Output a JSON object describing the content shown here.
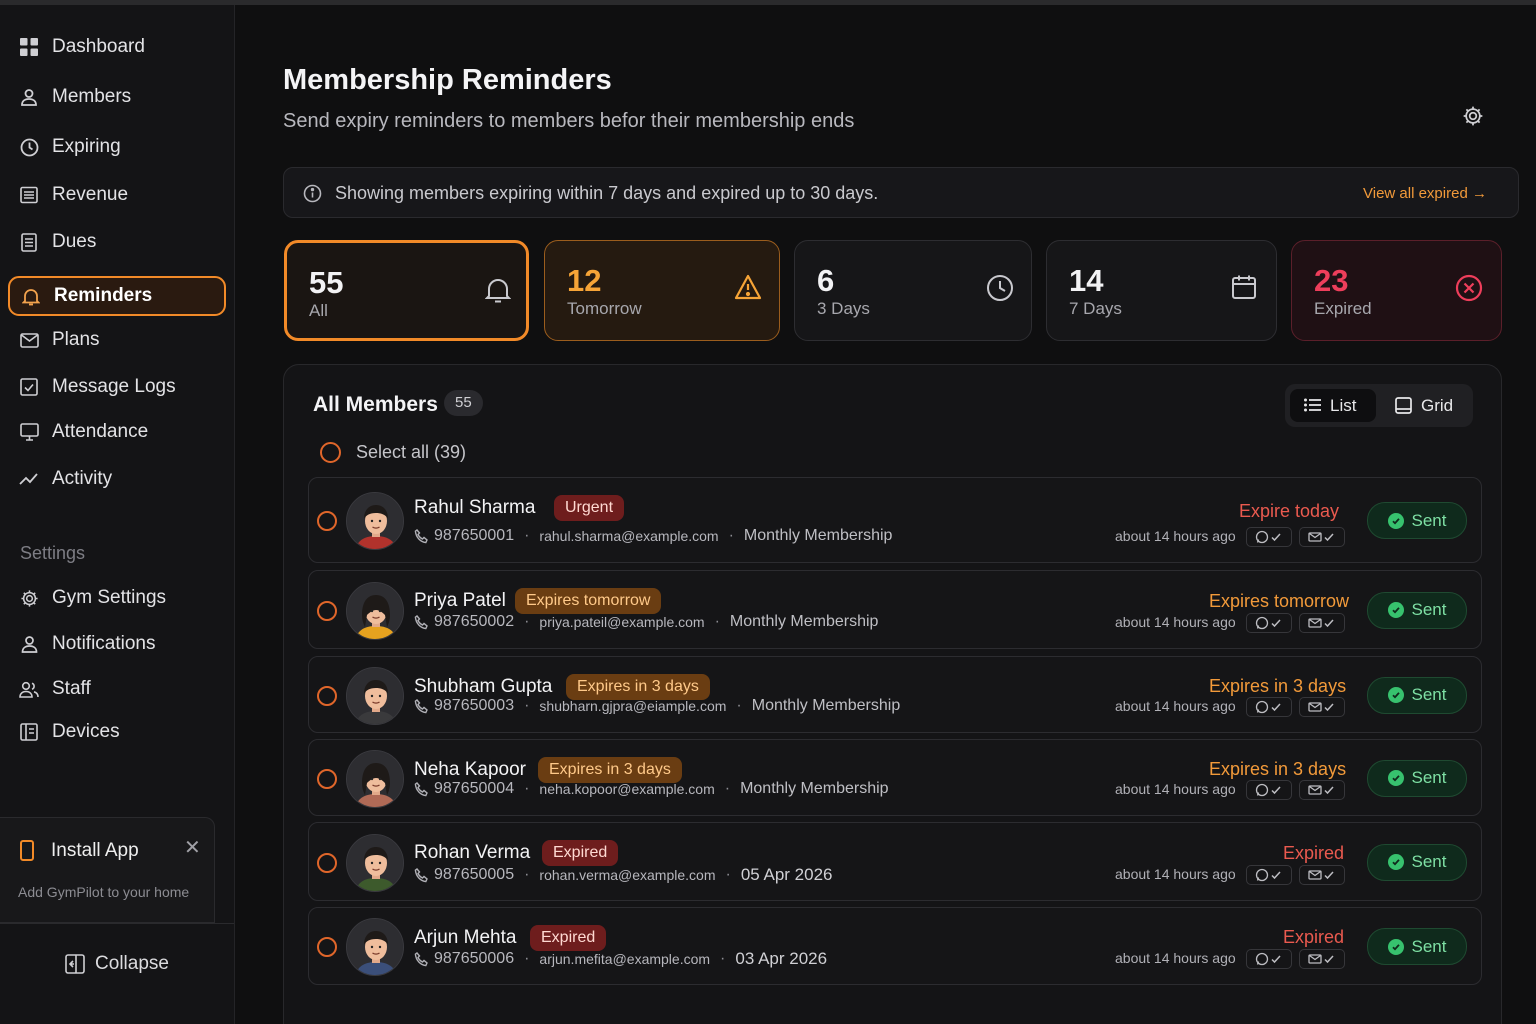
{
  "sidebar": {
    "items": [
      {
        "label": "Dashboard",
        "icon": "grid-icon"
      },
      {
        "label": "Members",
        "icon": "user-icon"
      },
      {
        "label": "Expiring",
        "icon": "clock-icon"
      },
      {
        "label": "Revenue",
        "icon": "receipt-icon"
      },
      {
        "label": "Dues",
        "icon": "document-icon"
      },
      {
        "label": "Reminders",
        "icon": "bell-icon",
        "active": true
      },
      {
        "label": "Plans",
        "icon": "mail-icon"
      },
      {
        "label": "Message Logs",
        "icon": "checkbox-icon"
      },
      {
        "label": "Attendance",
        "icon": "monitor-icon"
      },
      {
        "label": "Activity",
        "icon": "trend-icon"
      }
    ],
    "settings_label": "Settings",
    "settings_items": [
      {
        "label": "Gym Settings",
        "icon": "gear-icon"
      },
      {
        "label": "Notifications",
        "icon": "user-bell-icon"
      },
      {
        "label": "Staff",
        "icon": "users-icon"
      },
      {
        "label": "Devices",
        "icon": "device-icon"
      }
    ],
    "install": {
      "title": "Install App",
      "subtitle": "Add GymPilot to your home"
    },
    "collapse_label": "Collapse"
  },
  "header": {
    "title": "Membership Reminders",
    "subtitle": "Send expiry reminders to members befor their membership ends"
  },
  "info_bar": {
    "text": "Showing members expiring within 7 days and expired up to 30 days.",
    "link": "View all expired →"
  },
  "stats": [
    {
      "count": "55",
      "label": "All"
    },
    {
      "count": "12",
      "label": "Tomorrow"
    },
    {
      "count": "6",
      "label": "3 Days"
    },
    {
      "count": "14",
      "label": "7 Days"
    },
    {
      "count": "23",
      "label": "Expired"
    }
  ],
  "panel": {
    "title": "All Members",
    "count": "55",
    "view_list": "List",
    "view_grid": "Grid",
    "select_all": "Select all (39)"
  },
  "members": [
    {
      "name": "Rahul Sharma",
      "badge": "Urgent",
      "phone": "987650001",
      "email": "rahul.sharma@example.com",
      "plan": "Monthly Membership",
      "status": "Expire today",
      "ago": "about 14 hours ago",
      "action": "Sent"
    },
    {
      "name": "Priya Patel",
      "badge": "Expires tomorrow",
      "phone": "987650002",
      "email": "priya.pateil@example.com",
      "plan": "Monthly Membership",
      "status": "Expires tomorrow",
      "ago": "about 14 hours ago",
      "action": "Sent"
    },
    {
      "name": "Shubham Gupta",
      "badge": "Expires in 3 days",
      "phone": "987650003",
      "email": "shubharn.gjpra@eiample.com",
      "plan": "Monthly Membership",
      "status": "Expires in 3 days",
      "ago": "about 14 hours ago",
      "action": "Sent"
    },
    {
      "name": "Neha Kapoor",
      "badge": "Expires in 3 days",
      "phone": "987650004",
      "email": "neha.kopoor@example.com",
      "plan": "Monthly Membership",
      "status": "Expires in 3 days",
      "ago": "about 14 hours ago",
      "action": "Sent"
    },
    {
      "name": "Rohan Verma",
      "badge": "Expired",
      "phone": "987650005",
      "email": "rohan.verma@example.com",
      "plan": "05 Apr 2026",
      "status": "Expired",
      "ago": "about 14 hours ago",
      "action": "Sent"
    },
    {
      "name": "Arjun Mehta",
      "badge": "Expired",
      "phone": "987650006",
      "email": "arjun.mefita@example.com",
      "plan": "03 Apr 2026",
      "status": "Expired",
      "ago": "about 14 hours ago",
      "action": "Sent"
    }
  ],
  "colors": {
    "accent": "#f28a28",
    "expired": "#ee3e5b",
    "sent": "#7ee0a4"
  }
}
